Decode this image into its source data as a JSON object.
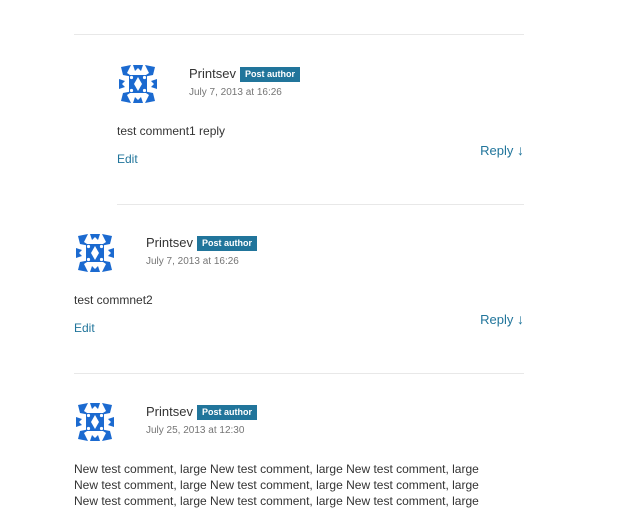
{
  "comments": [
    {
      "author": "Printsev",
      "badge": "Post author",
      "date": "July 7, 2013 at 16:26",
      "text": "test comment1 reply",
      "edit_label": "Edit",
      "reply_label": "Reply",
      "reply_arrow": "↓"
    },
    {
      "author": "Printsev",
      "badge": "Post author",
      "date": "July 7, 2013 at 16:26",
      "text": "test commnet2",
      "edit_label": "Edit",
      "reply_label": "Reply",
      "reply_arrow": "↓"
    },
    {
      "author": "Printsev",
      "badge": "Post author",
      "date": "July 25, 2013 at 12:30",
      "text_lines": [
        "New test comment, large New test comment, large New test comment, large",
        "New test comment, large New test comment, large New test comment, large",
        "New test comment, large New test comment, large New test comment, large"
      ]
    }
  ],
  "colors": {
    "link": "#21759b",
    "badge_bg": "#21759b",
    "avatar": "#1b6ad0"
  },
  "icons": {
    "avatar": "identicon-avatar"
  }
}
